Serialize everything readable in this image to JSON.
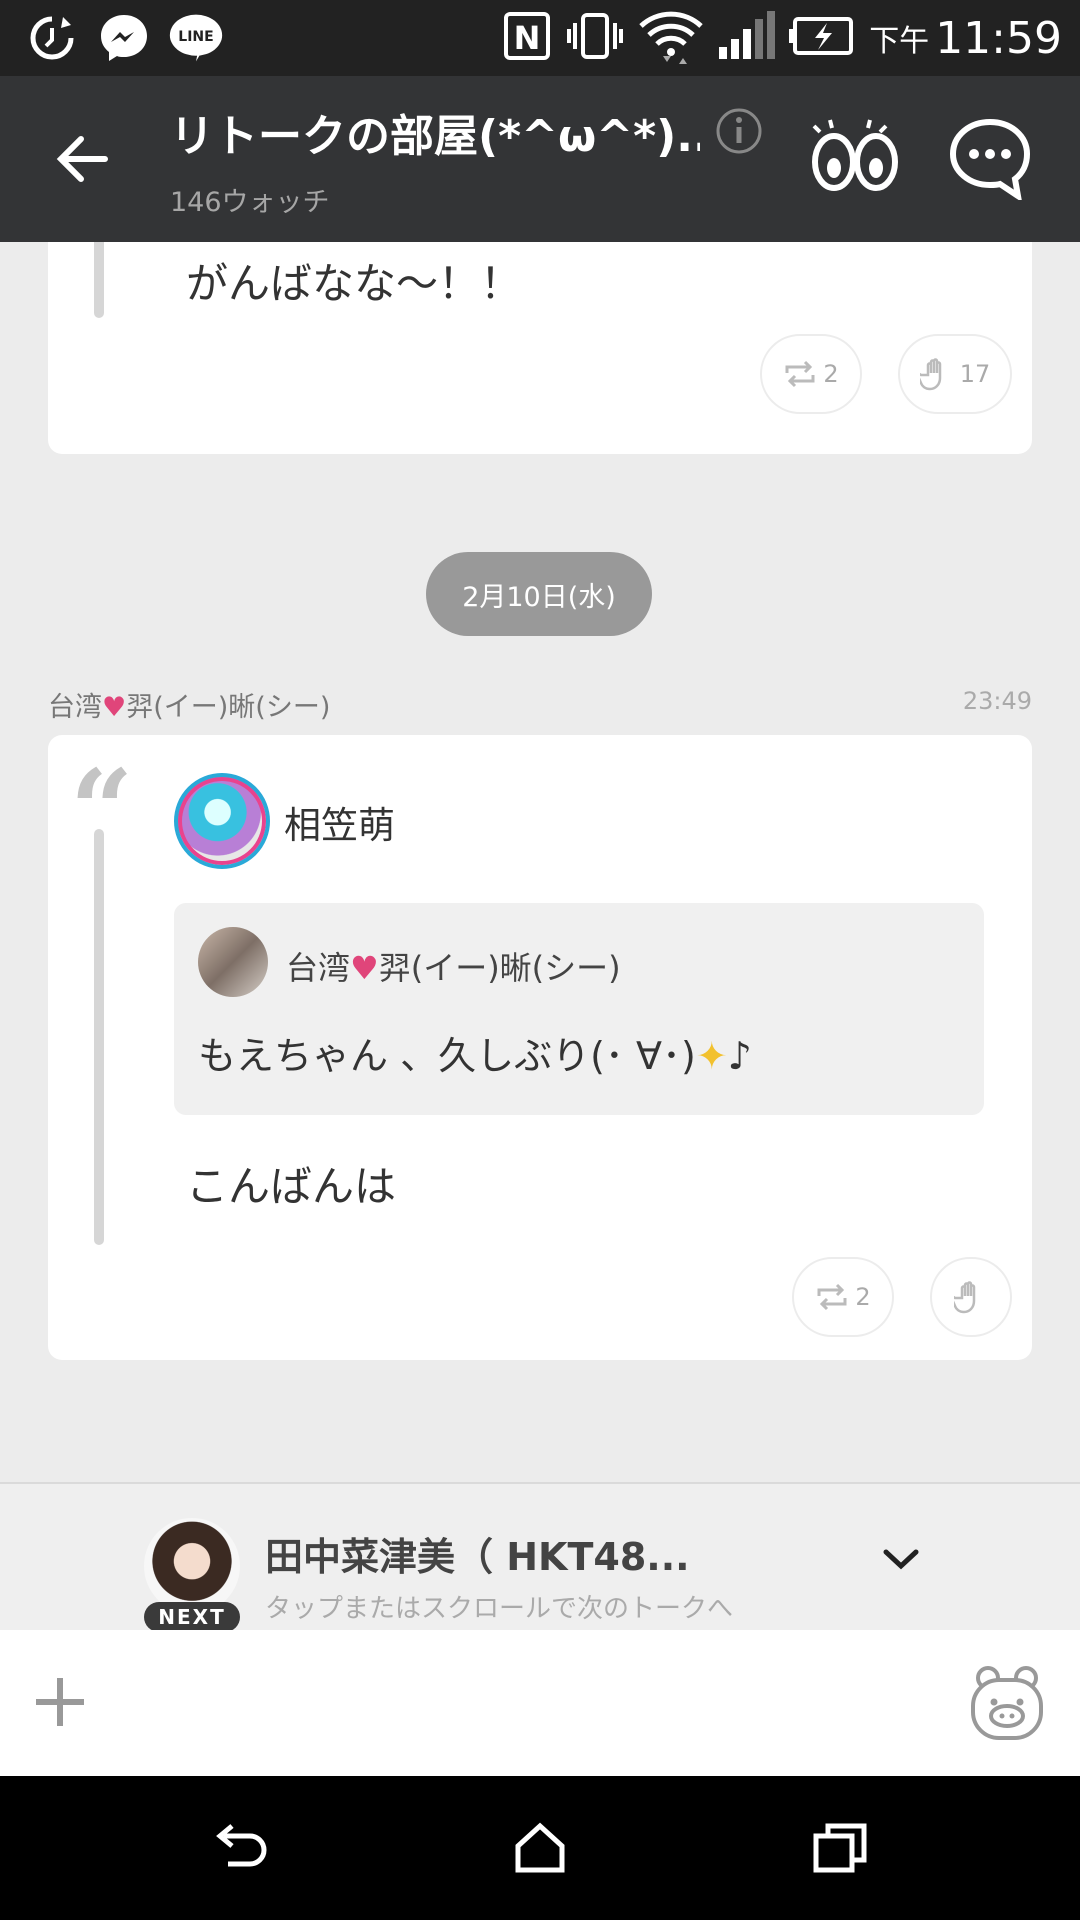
{
  "status_bar": {
    "ampm": "下午",
    "time": "11:59",
    "left_icons": [
      "sync-icon",
      "messenger-icon",
      "line-icon"
    ],
    "line_label": "LINE",
    "nfc_label": "N",
    "right_icons": [
      "nfc-icon",
      "vibrate-icon",
      "wifi-icon",
      "signal-icon",
      "battery-icon"
    ]
  },
  "header": {
    "title": "リトークの部屋(*^ω^*)...",
    "subtitle": "146ウォッチ"
  },
  "messages": [
    {
      "text": "がんばなな〜！！",
      "retalk_count": "2",
      "clap_count": "17"
    }
  ],
  "date_divider": "2月10日(水)",
  "post": {
    "sender_prefix": "台湾",
    "sender_suffix": "羿(イー)晰(シー)",
    "time": "23:49",
    "author": "相笠萌",
    "reply": {
      "name_prefix": "台湾",
      "name_suffix": "羿(イー)晰(シー)",
      "text": "もえちゃん 、久しぶり(･ ∀･)",
      "text_suffix": "♪"
    },
    "text": "こんばんは",
    "retalk_count": "2"
  },
  "next_talk": {
    "label": "NEXT",
    "title": "田中菜津美（ HKT48...",
    "subtitle": "タップまたはスクロールで次のトークへ"
  },
  "colors": {
    "status_bar": "#222222",
    "header": "#333436",
    "background": "#ececec",
    "date_chip": "#999999"
  }
}
